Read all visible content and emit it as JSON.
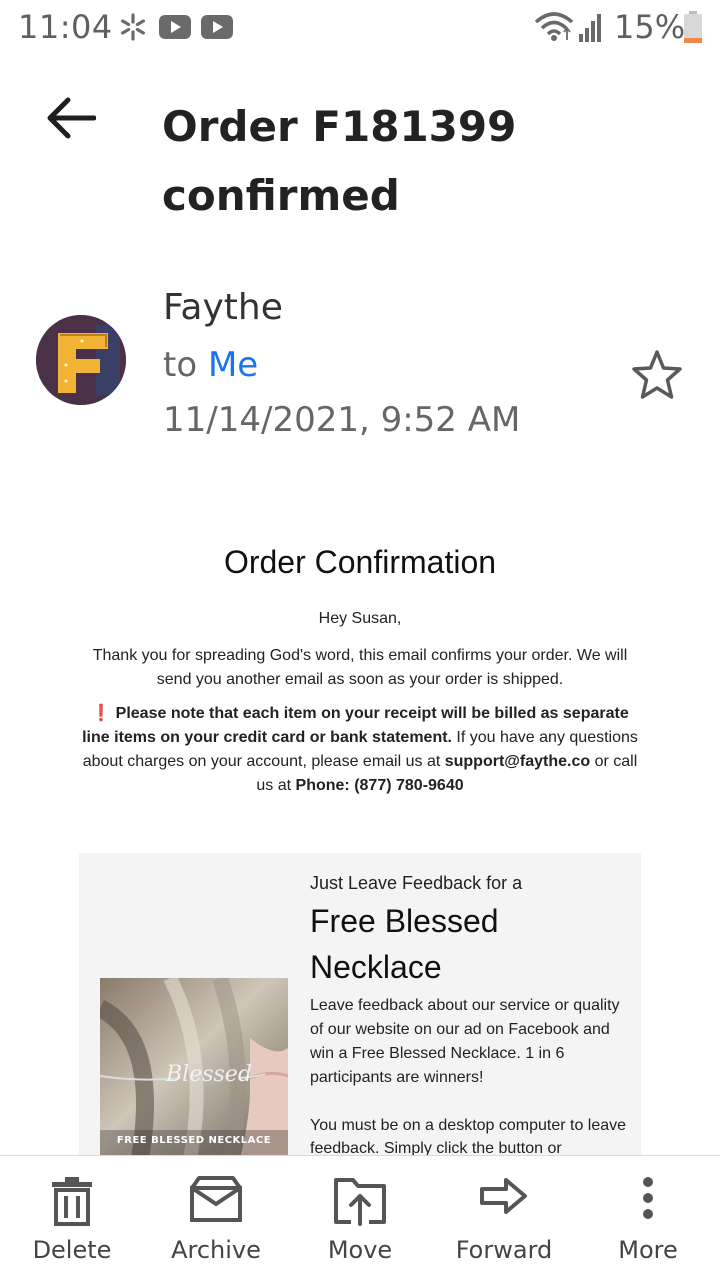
{
  "status_bar": {
    "time": "11:04",
    "battery": "15%",
    "icons": [
      "walmart-spark-icon",
      "youtube-icon",
      "youtube-icon",
      "wifi-icon",
      "signal-icon",
      "battery-icon"
    ]
  },
  "header": {
    "subject": "Order F181399 confirmed",
    "back_icon": "arrow-left-icon"
  },
  "sender": {
    "name": "Faythe",
    "to_prefix": "to",
    "recipient": "Me",
    "datetime": "11/14/2021, 9:52 AM",
    "avatar_letter": "F",
    "star_icon": "star-outline-icon"
  },
  "email": {
    "title": "Order Confirmation",
    "greeting": "Hey Susan,",
    "para1": "Thank you for spreading God's word, this email confirms your order. We will send you another email as soon as your order is shipped.",
    "warning_mark": "❗",
    "para2_bold": "Please note that each item on your receipt will be billed as separate line items on your credit card or bank statement.",
    "para2_text": " If you have any questions about charges on your account, please email us at ",
    "support_email": "support@faythe.co",
    "para2_text2": " or call us at ",
    "phone": "Phone: (877) 780-9640"
  },
  "promo": {
    "kicker": "Just Leave Feedback for a",
    "headline": "Free Blessed Necklace",
    "description": "Leave feedback about our service or quality of our website on our ad on Facebook and win a Free Blessed Necklace. 1 in 6 participants are winners!",
    "description2": "You must be on a desktop computer to leave feedback. Simply click the button or",
    "image_caption": "FREE BLESSED NECKLACE",
    "necklace_text": "Blessed"
  },
  "actions": [
    {
      "label": "Delete",
      "icon": "trash-icon"
    },
    {
      "label": "Archive",
      "icon": "archive-icon"
    },
    {
      "label": "Move",
      "icon": "move-icon"
    },
    {
      "label": "Forward",
      "icon": "forward-icon"
    },
    {
      "label": "More",
      "icon": "more-vertical-icon"
    }
  ],
  "colors": {
    "link_blue": "#1a73e8",
    "avatar_bg": "#4a3148",
    "avatar_letter": "#f2b233",
    "promo_bg": "#f4f4f4"
  }
}
